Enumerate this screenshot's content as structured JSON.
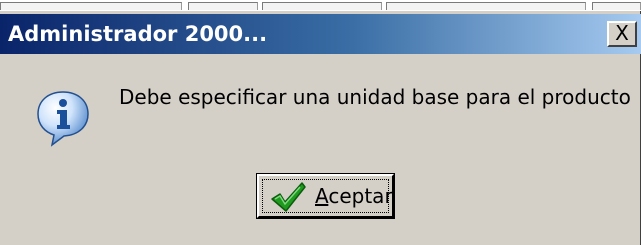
{
  "window": {
    "title": "Administrador 2000...",
    "close_glyph": "X"
  },
  "dialog": {
    "icon": "info-icon",
    "message": "Debe especificar una unidad base para el producto",
    "accept_button": {
      "label_accel": "A",
      "label_rest": "ceptar",
      "icon": "checkmark-icon"
    }
  },
  "colors": {
    "titlebar_start": "#0a246a",
    "titlebar_end": "#a6caf0",
    "dialog_face": "#d4d0c8",
    "check_green": "#1f9a1f",
    "info_blue": "#1a5fb4"
  }
}
